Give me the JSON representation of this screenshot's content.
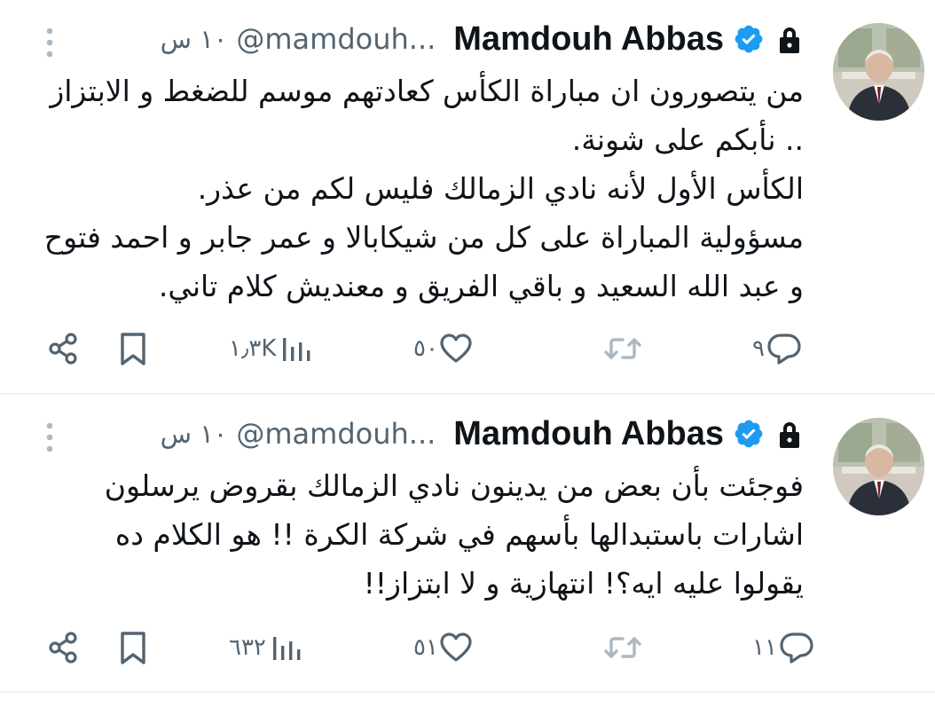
{
  "tweets": [
    {
      "name": "Mamdouh Abbas",
      "handle": "@mamdouh...",
      "time": "١٠ س",
      "text": "من يتصورون ان مباراة الكأس كعادتهم موسم للضغط و الابتزاز .. نأبكم على شونة.\nالكأس الأول لأنه نادي الزمالك فليس لكم من عذر.\nمسؤولية المباراة على كل من شيكابالا و عمر جابر و احمد فتوح و عبد الله السعيد و باقي الفريق و معنديش كلام تاني.",
      "replies": "٩",
      "likes": "٥٠",
      "views": "١٫٣K"
    },
    {
      "name": "Mamdouh Abbas",
      "handle": "@mamdouh...",
      "time": "١٠ س",
      "text": "فوجئت بأن بعض من يدينون نادي الزمالك بقروض يرسلون اشارات باستبدالها بأسهم في شركة الكرة !! هو الكلام ده يقولوا عليه ايه؟! انتهازية و لا ابتزاز!!",
      "replies": "١١",
      "likes": "٥١",
      "views": "٦٣٢"
    }
  ],
  "icons": {
    "more": "more-vertical-icon",
    "verified": "verified-badge-icon",
    "lock": "lock-icon",
    "reply": "reply-icon",
    "retweet": "retweet-icon",
    "like": "heart-icon",
    "views": "views-icon",
    "bookmark": "bookmark-icon",
    "share": "share-icon"
  },
  "colors": {
    "text": "#0f1419",
    "muted": "#536471",
    "verified": "#1d9bf0",
    "retweet_disabled": "#aab8c2",
    "divider": "#eff3f4"
  }
}
